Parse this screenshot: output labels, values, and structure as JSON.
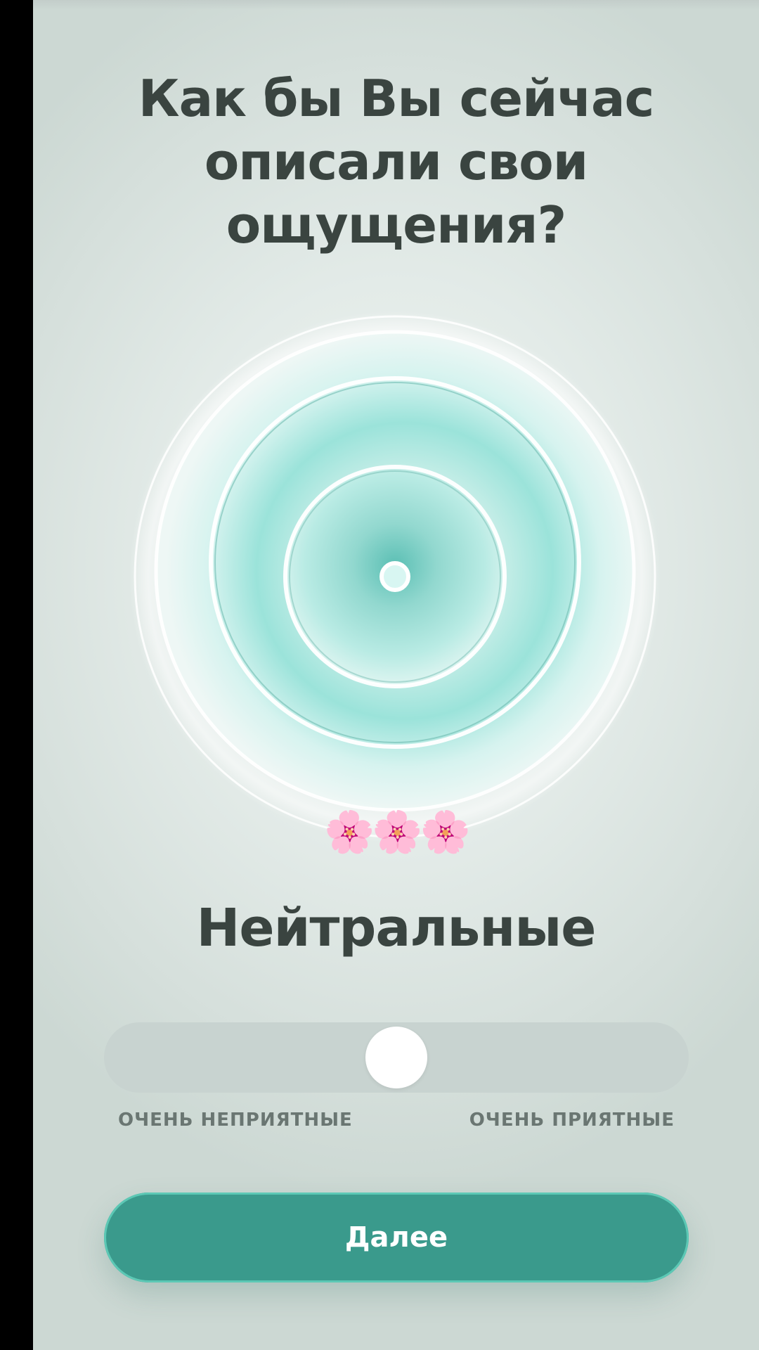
{
  "question": {
    "title": "Как бы Вы сейчас\nописали свои\nощущения?"
  },
  "orb": {
    "icon": "mood-orb-icon",
    "colors": {
      "core": "#7fd9cf",
      "ring": "#ffffff",
      "glow": "#bfece5"
    }
  },
  "decoration": {
    "flowers": "🌸🌸🌸",
    "icon": "cherry-blossom-icon"
  },
  "feeling": {
    "label": "Нейтральные"
  },
  "slider": {
    "value_percent": 50,
    "min_label": "ОЧЕНЬ НЕПРИЯТНЫЕ",
    "max_label": "ОЧЕНЬ ПРИЯТНЫЕ"
  },
  "actions": {
    "next_label": "Далее"
  },
  "colors": {
    "accent": "#3a9a8c",
    "accent_border": "#5cc8b5",
    "text": "#3a4440",
    "muted_text": "#6a7672",
    "track": "#c8d3d0"
  }
}
